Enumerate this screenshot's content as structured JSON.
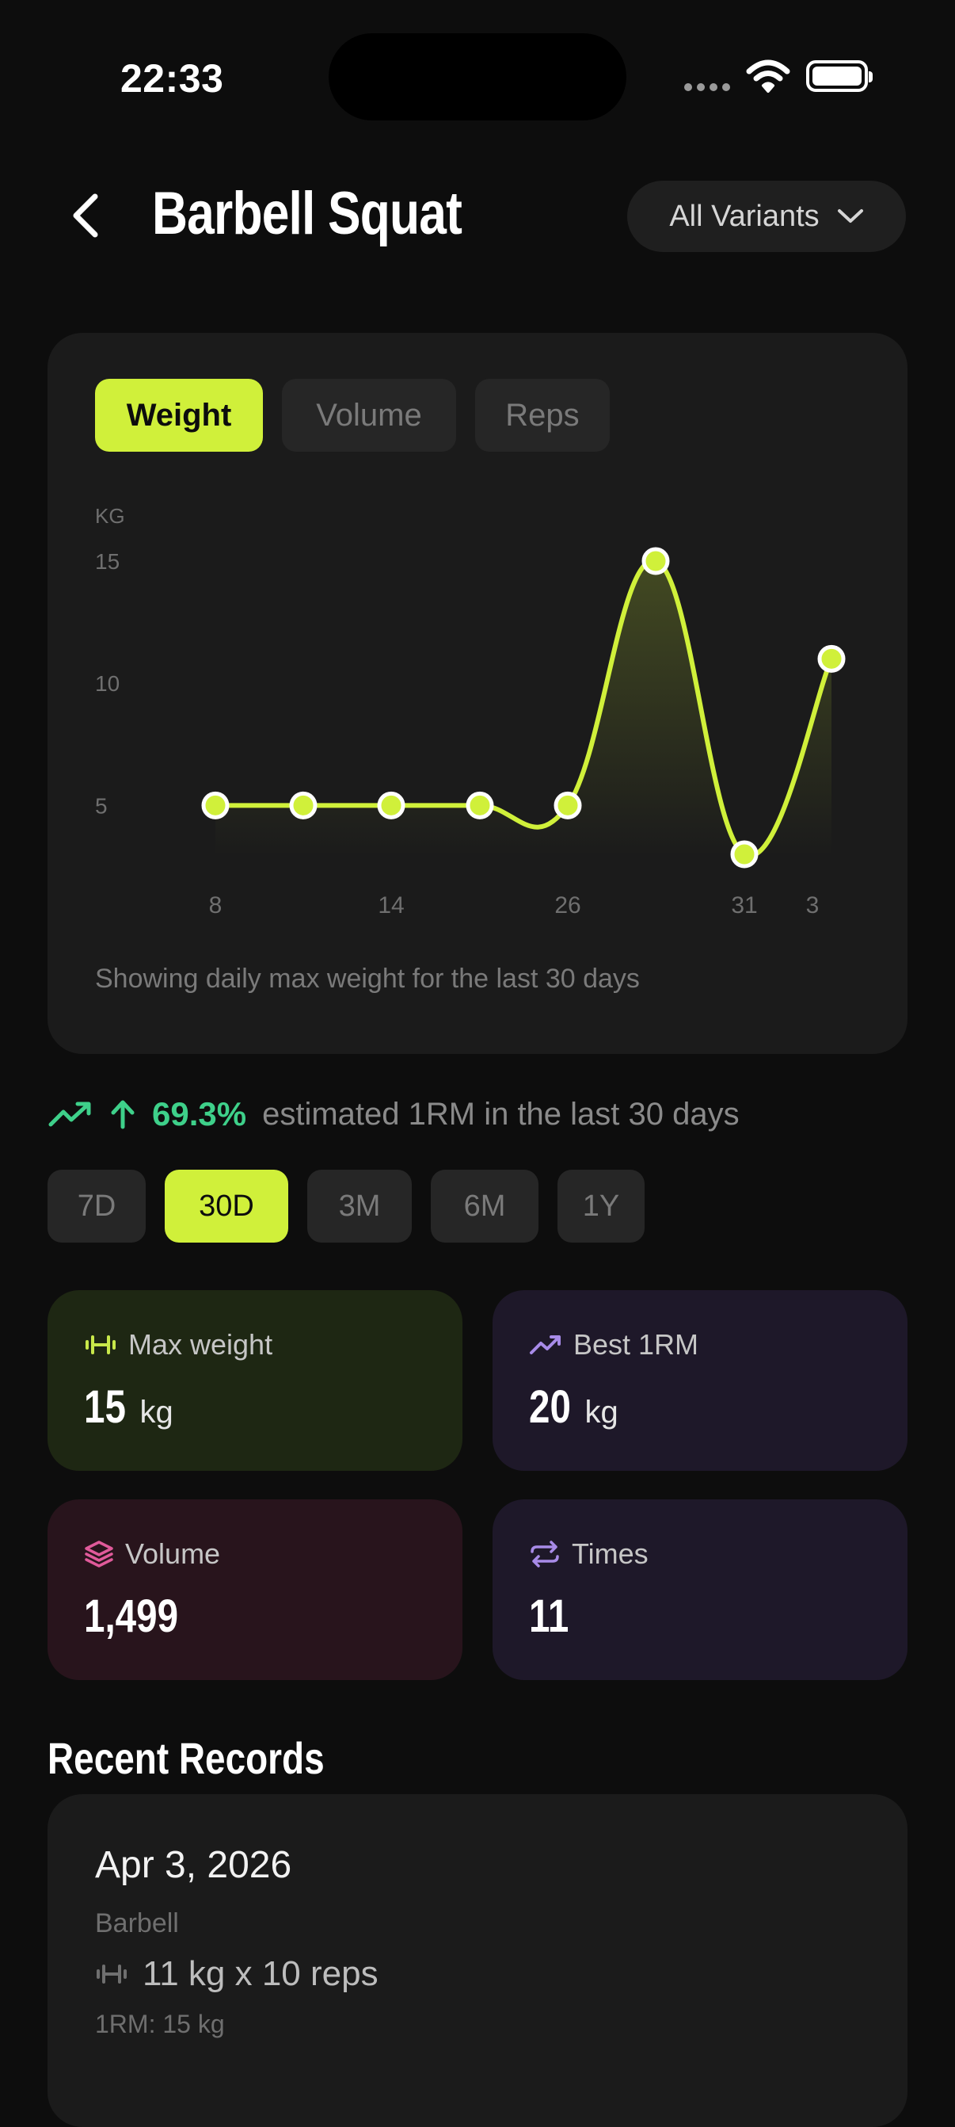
{
  "status_bar": {
    "time": "22:33"
  },
  "header": {
    "title": "Barbell Squat",
    "variant_selector": "All Variants"
  },
  "chart_tabs": [
    {
      "label": "Weight",
      "active": true
    },
    {
      "label": "Volume",
      "active": false
    },
    {
      "label": "Reps",
      "active": false
    }
  ],
  "chart_data": {
    "type": "line",
    "ylabel": "KG",
    "x_ticks": [
      "8",
      "14",
      "26",
      "31",
      "3"
    ],
    "y_ticks": [
      5,
      10,
      15
    ],
    "ylim": [
      2.5,
      16
    ],
    "points": [
      {
        "x": "8",
        "y": 5
      },
      {
        "x": "11",
        "y": 5
      },
      {
        "x": "14",
        "y": 5
      },
      {
        "x": "20",
        "y": 5
      },
      {
        "x": "26",
        "y": 5
      },
      {
        "x": "29",
        "y": 15
      },
      {
        "x": "31",
        "y": 3
      },
      {
        "x": "3",
        "y": 11
      }
    ],
    "color": "#d0f03a",
    "caption": "Showing daily max weight for the last 30 days"
  },
  "trend": {
    "percent": "69.3%",
    "text": "estimated 1RM in the last 30 days",
    "color": "#3ed08a"
  },
  "ranges": [
    {
      "label": "7D",
      "active": false
    },
    {
      "label": "30D",
      "active": true
    },
    {
      "label": "3M",
      "active": false
    },
    {
      "label": "6M",
      "active": false
    },
    {
      "label": "1Y",
      "active": false
    }
  ],
  "stats": {
    "max_weight": {
      "label": "Max weight",
      "value": "15",
      "unit": "kg",
      "icon": "dumbbell-icon",
      "color": "#c8e84a"
    },
    "best_1rm": {
      "label": "Best 1RM",
      "value": "20",
      "unit": "kg",
      "icon": "trend-up-icon",
      "color": "#a88be8"
    },
    "volume": {
      "label": "Volume",
      "value": "1,499",
      "icon": "layers-icon",
      "color": "#e05a9a"
    },
    "times": {
      "label": "Times",
      "value": "11",
      "icon": "repeat-icon",
      "color": "#a88be8"
    }
  },
  "recent": {
    "title": "Recent Records",
    "records": [
      {
        "date": "Apr 3, 2026",
        "equipment": "Barbell",
        "sets": "11 kg x 10 reps",
        "one_rm": "1RM: 15 kg"
      }
    ]
  }
}
